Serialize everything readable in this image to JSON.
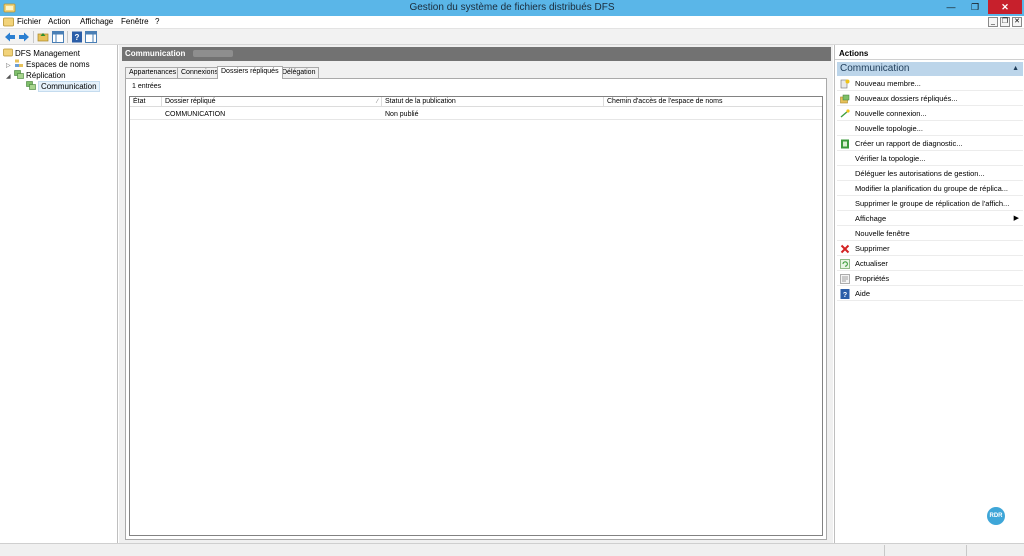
{
  "window": {
    "title": "Gestion du système de fichiers distribués DFS",
    "minimize": "—",
    "restore": "❐",
    "close": "✕"
  },
  "menu": {
    "items": [
      "Fichier",
      "Action",
      "Affichage",
      "Fenêtre",
      "?"
    ],
    "mdi_minimize": "_",
    "mdi_restore": "❐",
    "mdi_close": "✕"
  },
  "tree": {
    "root": "DFS Management",
    "namespaces": "Espaces de noms",
    "replication": "Réplication",
    "group": "Communication"
  },
  "center": {
    "header": "Communication",
    "tabs": [
      "Appartenances",
      "Connexions",
      "Dossiers répliqués",
      "Délégation"
    ],
    "active_tab": "Dossiers répliqués",
    "count": "1 entrées",
    "columns": [
      "État",
      "Dossier répliqué",
      "Statut de la publication",
      "Chemin d'accès de l'espace de noms"
    ],
    "rows": [
      {
        "state": "",
        "folder": "COMMUNICATION",
        "status": "Non publié",
        "path": ""
      }
    ]
  },
  "actions": {
    "title": "Actions",
    "section": "Communication",
    "items": [
      {
        "label": "Nouveau membre...",
        "icon": "new-member-icon"
      },
      {
        "label": "Nouveaux dossiers répliqués...",
        "icon": "new-folders-icon"
      },
      {
        "label": "Nouvelle connexion...",
        "icon": "new-connection-icon"
      },
      {
        "label": "Nouvelle topologie...",
        "icon": ""
      },
      {
        "label": "Créer un rapport de diagnostic...",
        "icon": "diagnostic-report-icon"
      },
      {
        "label": "Vérifier la topologie...",
        "icon": ""
      },
      {
        "label": "Déléguer les autorisations de gestion...",
        "icon": ""
      },
      {
        "label": "Modifier la planification du groupe de réplica...",
        "icon": ""
      },
      {
        "label": "Supprimer le groupe de réplication de l'affich...",
        "icon": ""
      },
      {
        "label": "Affichage",
        "icon": ""
      },
      {
        "label": "Nouvelle fenêtre",
        "icon": ""
      },
      {
        "label": "Supprimer",
        "icon": "delete-icon"
      },
      {
        "label": "Actualiser",
        "icon": "refresh-icon"
      },
      {
        "label": "Propriétés",
        "icon": "properties-icon"
      },
      {
        "label": "Aide",
        "icon": "help-icon"
      }
    ],
    "collapse_caret": "▲",
    "submenu_arrow": "▶"
  },
  "branding": {
    "logo_text": "RDR"
  },
  "colors": {
    "titlebar": "#5ab6e8",
    "close": "#c7202c",
    "header": "#727272",
    "section": "#bcd5ea"
  }
}
